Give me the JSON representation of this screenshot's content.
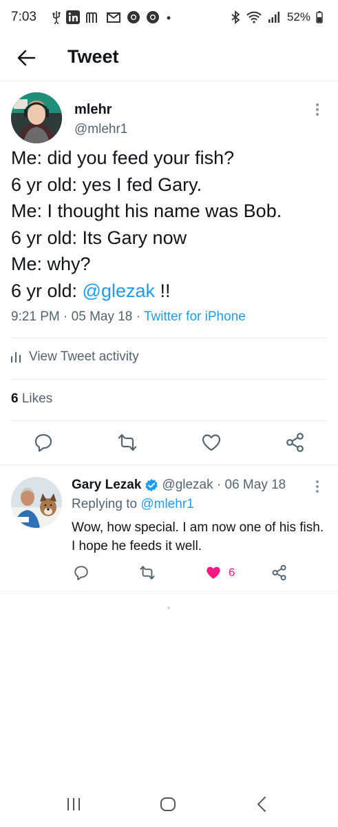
{
  "status_bar": {
    "time": "7:03",
    "battery": "52%",
    "left_icons": [
      "usb-icon",
      "linkedin-icon",
      "m-app-icon",
      "gmail-icon",
      "chrome-icon",
      "chrome-icon",
      "dot-icon"
    ],
    "right_icons": [
      "bluetooth-icon",
      "wifi-icon",
      "signal-icon",
      "battery-icon"
    ]
  },
  "header": {
    "title": "Tweet",
    "back_icon": "back-arrow-icon"
  },
  "tweet": {
    "author_name": "mlehr",
    "author_handle": "@mlehr1",
    "text_lines": [
      "Me: did you feed your fish?",
      "6 yr old: yes I fed Gary.",
      "Me: I thought his name was Bob.",
      "6 yr old: Its Gary now",
      "Me: why?"
    ],
    "last_line_prefix": "6 yr old: ",
    "last_line_mention": "@glezak",
    "last_line_suffix": " !!",
    "time": "9:21 PM",
    "date": "05 May 18",
    "source": "Twitter for iPhone",
    "meta_separator": " · ",
    "activity_label": "View Tweet activity",
    "likes_count": "6",
    "likes_label": "Likes"
  },
  "reply": {
    "author_name": "Gary Lezak",
    "author_handle": "@glezak",
    "date_separator": " · ",
    "date": "06 May 18",
    "replying_label": "Replying to ",
    "replying_mention": "@mlehr1",
    "text": "Wow, how special. I am now one of his fish. I hope he feeds it well.",
    "like_count": "6"
  },
  "colors": {
    "accent": "#1d9bf0",
    "text": "#0f1419",
    "secondary": "#536471",
    "like": "#f91880",
    "verified": "#1d9bf0"
  }
}
